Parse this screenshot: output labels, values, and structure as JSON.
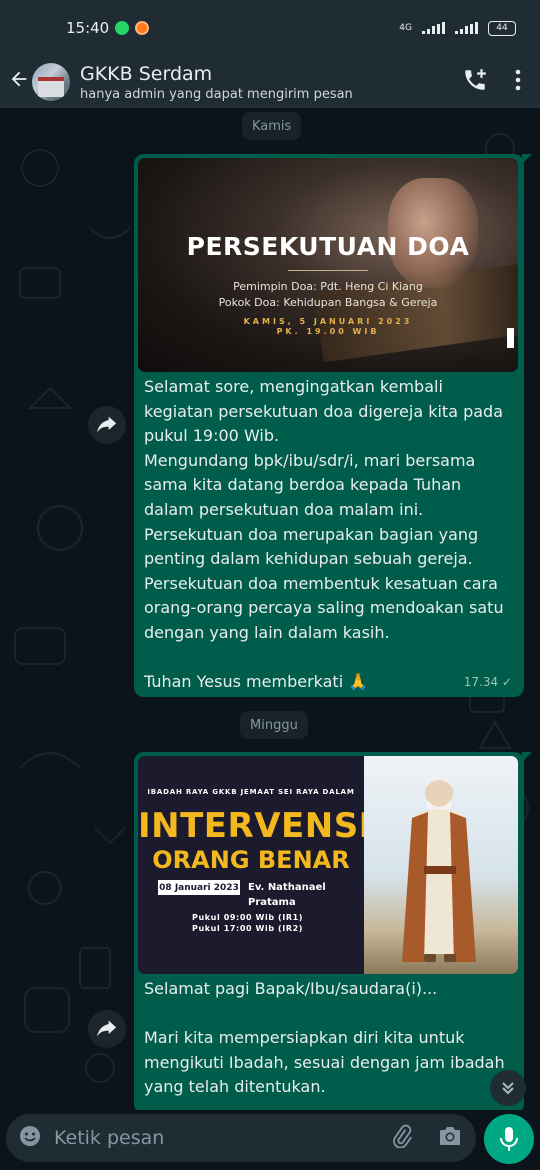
{
  "status_bar": {
    "time": "15:40",
    "network": "4G",
    "battery": "44"
  },
  "header": {
    "title": "GKKB Serdam",
    "subtitle": "hanya admin yang dapat mengirim pesan"
  },
  "messages": [
    {
      "day_label": "Kamis",
      "image": {
        "title": "PERSEKUTUAN DOA",
        "leader": "Pemimpin Doa: Pdt. Heng Ci Kiang",
        "topic": "Pokok Doa: Kehidupan Bangsa & Gereja",
        "date": "KAMIS, 5 JANUARI 2023",
        "time": "PK. 19.00 WIB"
      },
      "text": "Selamat sore, mengingatkan kembali kegiatan persekutuan doa digereja kita pada pukul 19:00 Wib.\nMengundang bpk/ibu/sdr/i, mari bersama sama kita datang berdoa kepada Tuhan dalam persekutuan doa malam ini.\nPersekutuan doa merupakan bagian yang penting dalam kehidupan sebuah gereja. Persekutuan doa membentuk kesatuan cara orang-orang percaya saling mendoakan satu dengan yang lain dalam kasih.\n\nTuhan Yesus memberkati 🙏",
      "time": "17.34 ✓"
    },
    {
      "day_label": "Minggu",
      "image": {
        "header": "IBADAH RAYA GKKB JEMAAT SEI RAYA DALAM",
        "title1": "INTERVENSI",
        "title2": "ORANG BENAR",
        "date": "08 Januari 2023",
        "speaker": "Ev. Nathanael Pratama",
        "time1": "Pukul 09:00 Wib (IR1)",
        "time2": "Pukul 17:00 Wib (IR2)"
      },
      "text": "Selamat pagi Bapak/Ibu/saudara(i)...\n\nMari kita mempersiapkan diri kita untuk mengikuti Ibadah, sesuai dengan jam ibadah yang telah ditentukan."
    }
  ],
  "composer": {
    "placeholder": "Ketik pesan"
  },
  "icons": {
    "back": "arrow-left-icon",
    "call": "add-call-icon",
    "menu": "more-vert-icon",
    "forward": "forward-icon",
    "scroll": "chevron-double-down-icon",
    "emoji": "emoji-icon",
    "attach": "paperclip-icon",
    "camera": "camera-icon",
    "mic": "mic-icon"
  },
  "colors": {
    "header_bg": "#1f2c34",
    "chat_bg": "#0b141a",
    "bubble_out": "#005c4b",
    "accent": "#00a884"
  }
}
